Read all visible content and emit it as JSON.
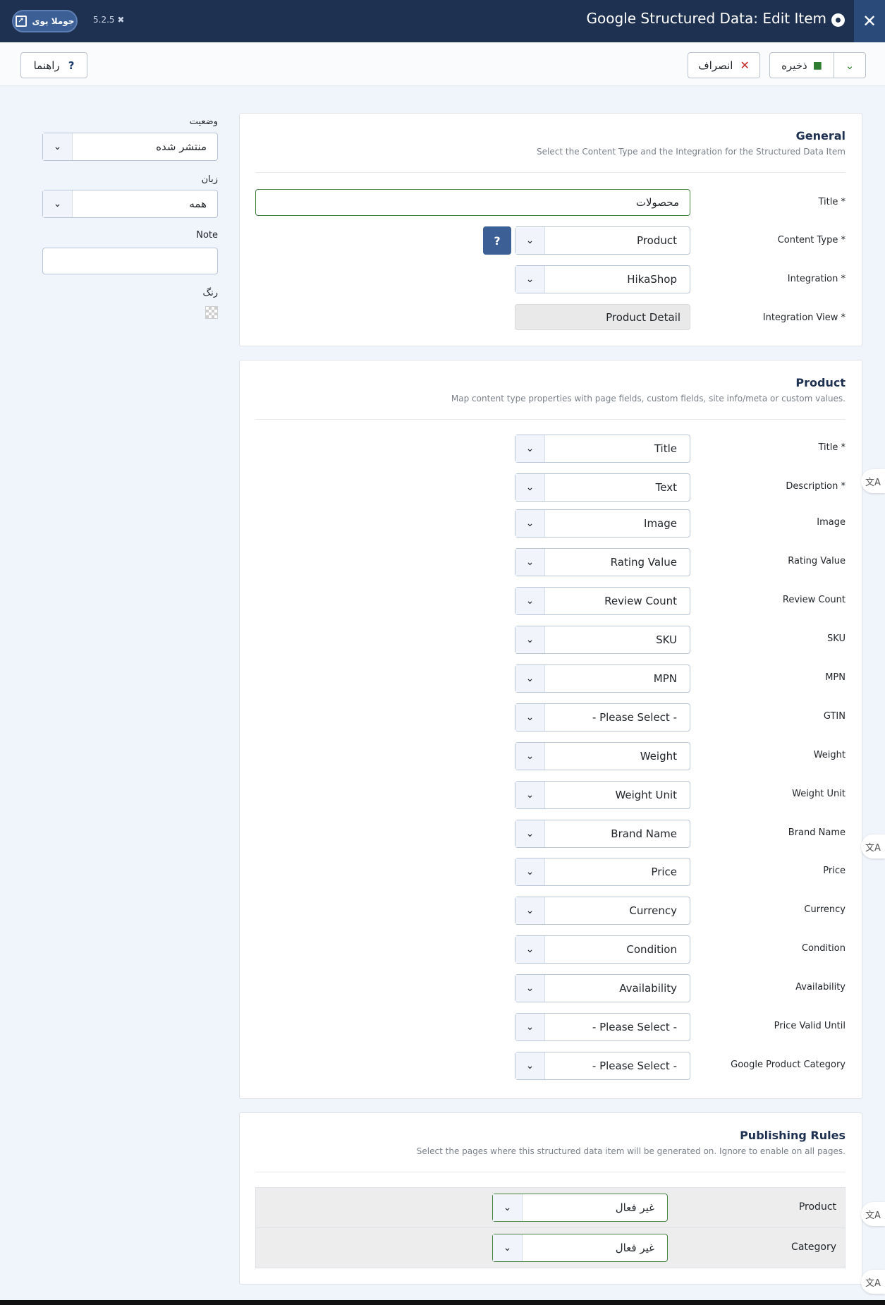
{
  "header": {
    "title": "Google Structured Data: Edit Item",
    "version": "5.2.5",
    "site_button_label": "جوملا یوی"
  },
  "toolbar": {
    "save_label": "ذخیره",
    "cancel_label": "انصراف",
    "help_label": "راهنما"
  },
  "general": {
    "heading": "General",
    "description": "Select the Content Type and the Integration for the Structured Data Item",
    "title_label": "Title *",
    "title_value": "محصولات",
    "content_type_label": "Content Type *",
    "content_type_value": "Product",
    "integration_label": "Integration *",
    "integration_value": "HikaShop",
    "integration_view_label": "Integration View *",
    "integration_view_value": "Product Detail"
  },
  "product": {
    "heading": "Product",
    "description": "Map content type properties with page fields, custom fields, site info/meta or custom values.",
    "fields": [
      {
        "label": "Title *",
        "value": "Title"
      },
      {
        "label": "Description *",
        "value": "Text"
      },
      {
        "label": "Image",
        "value": "Image"
      },
      {
        "label": "Rating Value",
        "value": "Rating Value"
      },
      {
        "label": "Review Count",
        "value": "Review Count"
      },
      {
        "label": "SKU",
        "value": "SKU"
      },
      {
        "label": "MPN",
        "value": "MPN"
      },
      {
        "label": "GTIN",
        "value": "- Please Select -"
      },
      {
        "label": "Weight",
        "value": "Weight"
      },
      {
        "label": "Weight Unit",
        "value": "Weight Unit"
      },
      {
        "label": "Brand Name",
        "value": "Brand Name"
      },
      {
        "label": "Price",
        "value": "Price"
      },
      {
        "label": "Currency",
        "value": "Currency"
      },
      {
        "label": "Condition",
        "value": "Condition"
      },
      {
        "label": "Availability",
        "value": "Availability"
      },
      {
        "label": "Price Valid Until",
        "value": "- Please Select -"
      },
      {
        "label": "Google Product Category",
        "value": "- Please Select -"
      }
    ]
  },
  "rules": {
    "heading": "Publishing Rules",
    "description": "Select the pages where this structured data item will be generated on. Ignore to enable on all pages.",
    "rows": [
      {
        "label": "Product",
        "value": "غیر فعال"
      },
      {
        "label": "Category",
        "value": "غیر فعال"
      }
    ]
  },
  "sidebar": {
    "status_label": "وضعیت",
    "status_value": "منتشر شده",
    "language_label": "زبان",
    "language_value": "همه",
    "note_label": "Note",
    "note_value": "",
    "color_label": "رنگ"
  },
  "colors": {
    "header_bg": "#1f3150",
    "accent": "#3c5f96",
    "save_green": "#2f7d32",
    "cancel_red": "#c52827"
  }
}
